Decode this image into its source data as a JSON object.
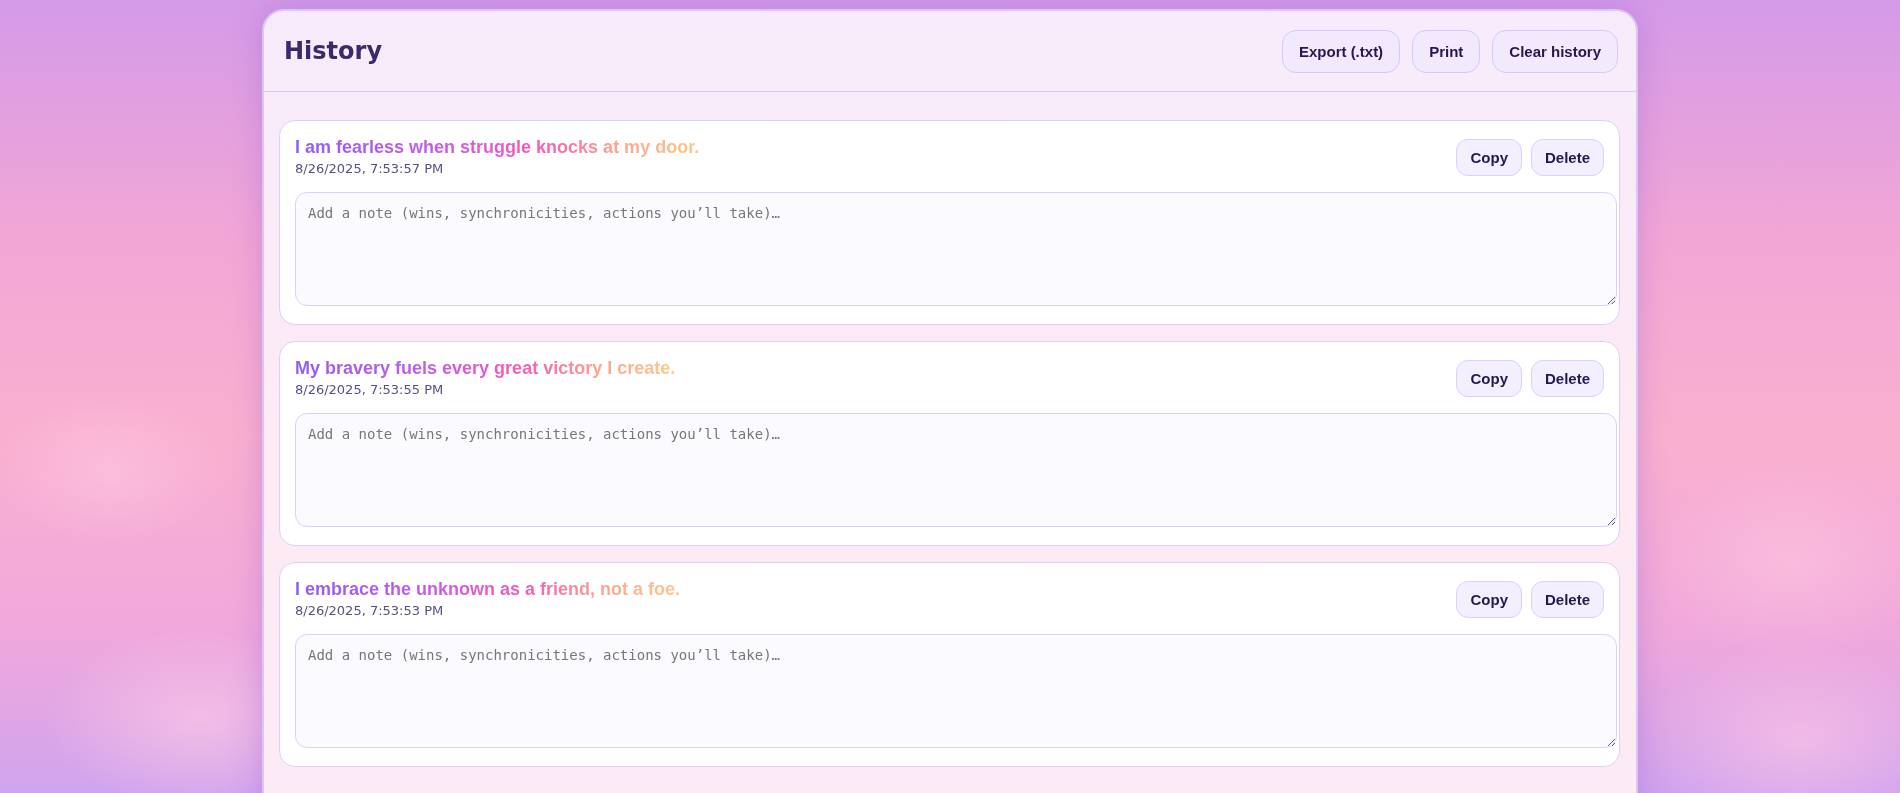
{
  "panel": {
    "title": "History",
    "actions": [
      {
        "label": "Export (.txt)"
      },
      {
        "label": "Print"
      },
      {
        "label": "Clear history"
      }
    ]
  },
  "entries": [
    {
      "text": "I am fearless when struggle knocks at my door.",
      "timestamp": "8/26/2025, 7:53:57 PM",
      "note_placeholder": "Add a note (wins, synchronicities, actions you’ll take)…",
      "buttons": [
        "Copy",
        "Delete"
      ]
    },
    {
      "text": "My bravery fuels every great victory I create.",
      "timestamp": "8/26/2025, 7:53:55 PM",
      "note_placeholder": "Add a note (wins, synchronicities, actions you’ll take)…",
      "buttons": [
        "Copy",
        "Delete"
      ]
    },
    {
      "text": "I embrace the unknown as a friend, not a foe.",
      "timestamp": "8/26/2025, 7:53:53 PM",
      "note_placeholder": "Add a note (wins, synchronicities, actions you’ll take)…",
      "buttons": [
        "Copy",
        "Delete"
      ]
    }
  ]
}
